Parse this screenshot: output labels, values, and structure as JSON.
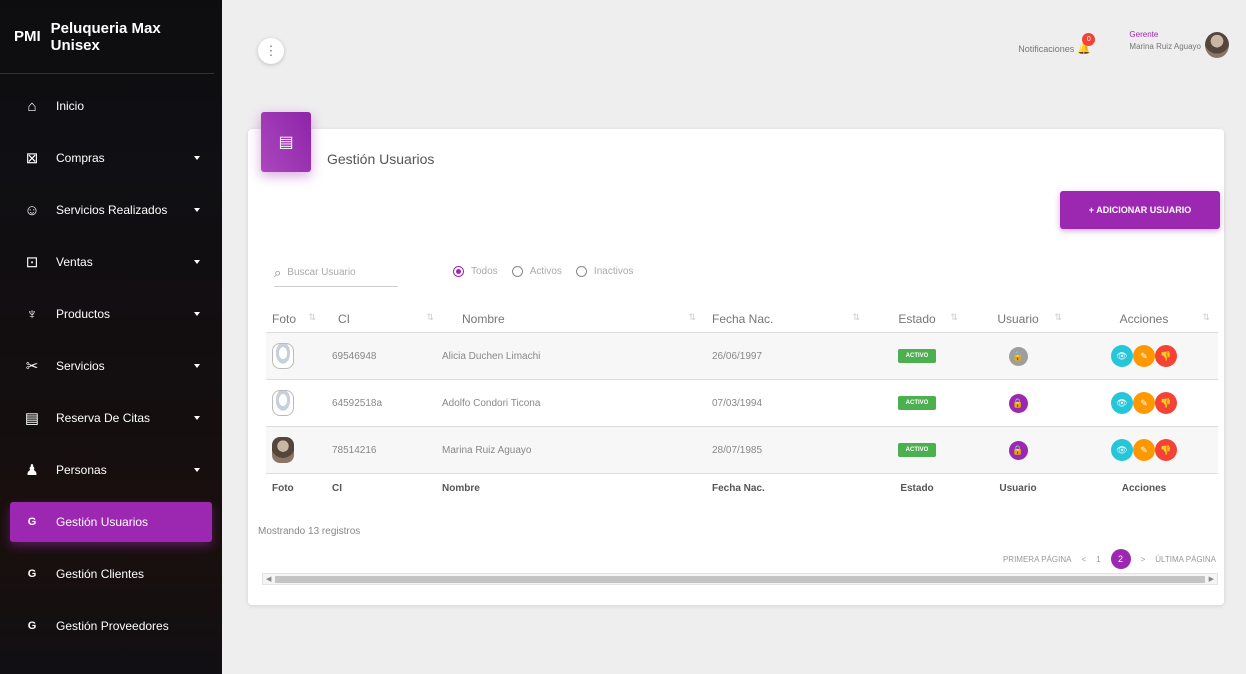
{
  "brand": {
    "mini": "PMI",
    "name": "Peluqueria Max Unisex"
  },
  "sidebar": {
    "items": [
      {
        "icon": "home-icon",
        "glyph": "⌂",
        "label": "Inicio",
        "caret": false
      },
      {
        "icon": "cart-off-icon",
        "glyph": "⊠",
        "label": "Compras",
        "caret": true
      },
      {
        "icon": "face-icon",
        "glyph": "☺",
        "label": "Servicios Realizados",
        "caret": true
      },
      {
        "icon": "cart-icon",
        "glyph": "⊡",
        "label": "Ventas",
        "caret": true
      },
      {
        "icon": "basket-icon",
        "glyph": "♆",
        "label": "Productos",
        "caret": true
      },
      {
        "icon": "scissors-icon",
        "glyph": "✂",
        "label": "Servicios",
        "caret": true
      },
      {
        "icon": "calendar-icon",
        "glyph": "▤",
        "label": "Reserva De Citas",
        "caret": true
      },
      {
        "icon": "person-icon",
        "glyph": "♟",
        "label": "Personas",
        "caret": true
      }
    ],
    "subitems": [
      {
        "abbr": "G",
        "label": "Gestión Usuarios",
        "active": true
      },
      {
        "abbr": "G",
        "label": "Gestión Clientes",
        "active": false
      },
      {
        "abbr": "G",
        "label": "Gestión Proveedores",
        "active": false
      }
    ]
  },
  "topbar": {
    "menu_glyph": "⋮",
    "notifications_label": "Notificaciones",
    "notifications_count": "0",
    "user_role": "Gerente",
    "user_name": "Marina Ruiz Aguayo"
  },
  "card": {
    "title": "Gestión Usuarios",
    "add_button": "+ ADICIONAR USUARIO",
    "search_placeholder": "Buscar Usuario",
    "filters": [
      {
        "label": "Todos",
        "selected": true
      },
      {
        "label": "Activos",
        "selected": false
      },
      {
        "label": "Inactivos",
        "selected": false
      }
    ]
  },
  "table": {
    "headers": {
      "foto": "Foto",
      "ci": "CI",
      "nombre": "Nombre",
      "fecha": "Fecha Nac.",
      "estado": "Estado",
      "usuario": "Usuario",
      "acciones": "Acciones"
    },
    "rows": [
      {
        "ci": "69546948",
        "nombre": "Alicia Duchen Limachi",
        "fecha": "26/06/1997",
        "estado": "ACTIVO",
        "avatar": "placeholder",
        "usuario": "inactive"
      },
      {
        "ci": "64592518a",
        "nombre": "Adolfo Condori Ticona",
        "fecha": "07/03/1994",
        "estado": "ACTIVO",
        "avatar": "placeholder",
        "usuario": "active"
      },
      {
        "ci": "78514216",
        "nombre": "Marina Ruiz Aguayo",
        "fecha": "28/07/1985",
        "estado": "ACTIVO",
        "avatar": "photo",
        "usuario": "active"
      }
    ]
  },
  "footer": {
    "count_text": "Mostrando 13 registros",
    "pager": {
      "first": "PRIMERA PÁGINA",
      "prev": "<",
      "page1": "1",
      "current": "2",
      "next": ">",
      "last": "ÚLTIMA PÁGINA"
    }
  },
  "colors": {
    "accent": "#9c27b0",
    "active_badge": "#4caf50",
    "view": "#26c6da",
    "edit": "#ff9800",
    "delete": "#f44336"
  }
}
